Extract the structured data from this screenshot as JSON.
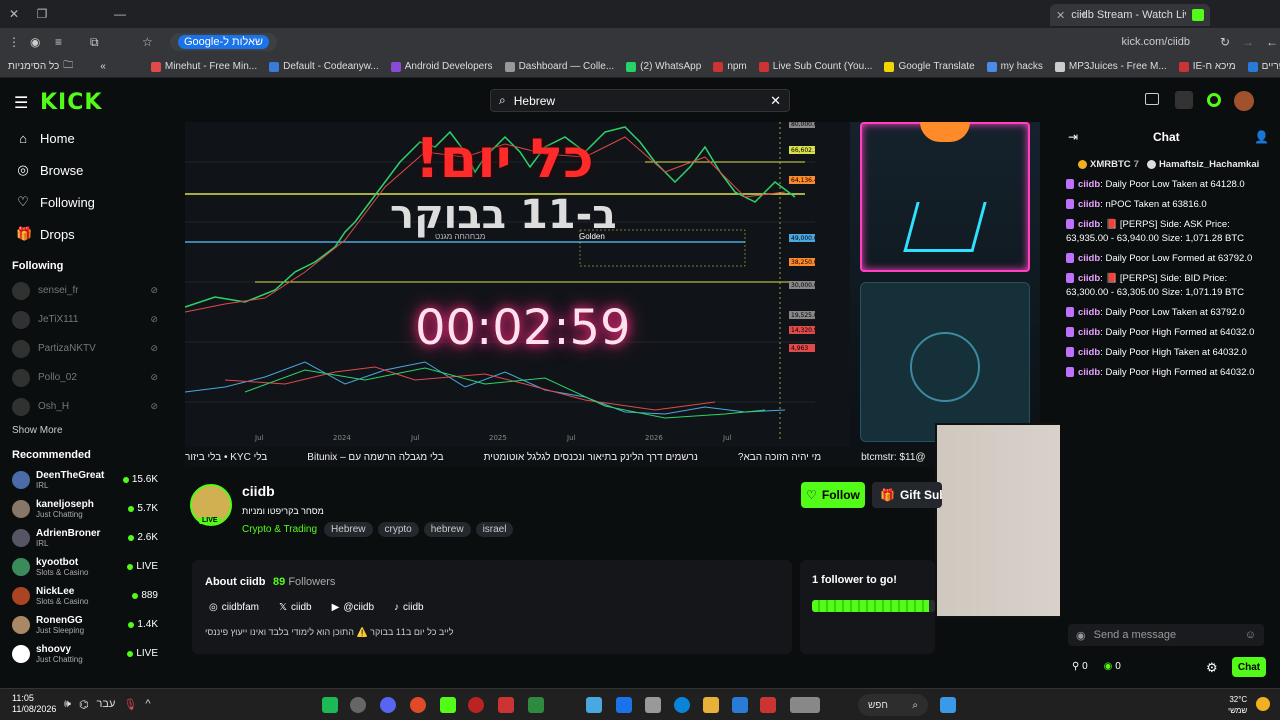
{
  "browser": {
    "tab_title": "ciidb Stream - Watch Live o",
    "omnibox_chip": "Google-שאלות ל",
    "url": "kick.com/ciidb",
    "bookmarks": [
      "Minehut - Free Min...",
      "Default - Codeanyw...",
      "Android Developers",
      "Dashboard — Colle...",
      "(2) WhatsApp",
      "npm",
      "Live Sub Count (You...",
      "Google Translate",
      "my hacks",
      "MP3Juices - Free M...",
      "IE-מיכא ח",
      "ספריים"
    ],
    "bookmarks_left": "כל הסימניות"
  },
  "header": {
    "logo": "KICK",
    "search_value": "Hebrew"
  },
  "sidebar": {
    "nav": [
      {
        "label": "Home",
        "icon": "home-icon"
      },
      {
        "label": "Browse",
        "icon": "compass-icon"
      },
      {
        "label": "Following",
        "icon": "heart-icon"
      },
      {
        "label": "Drops",
        "icon": "gift-icon"
      }
    ],
    "following_title": "Following",
    "following": [
      "sensei_fr",
      "JeTiX111",
      "PartizaNKTV",
      "Pollo_02",
      "Osh_H"
    ],
    "show_more": "Show More",
    "recommended_title": "Recommended",
    "recommended": [
      {
        "name": "DeenTheGreat",
        "category": "IRL",
        "viewers": "15.6K"
      },
      {
        "name": "kaneljoseph",
        "category": "Just Chatting",
        "viewers": "5.7K"
      },
      {
        "name": "AdrienBroner",
        "category": "IRL",
        "viewers": "2.6K"
      },
      {
        "name": "kyootbot",
        "category": "Slots & Casino",
        "viewers": "LIVE"
      },
      {
        "name": "NickLee",
        "category": "Slots & Casino",
        "viewers": "889"
      },
      {
        "name": "RonenGG",
        "category": "Just Sleeping",
        "viewers": "1.4K"
      },
      {
        "name": "shoovy",
        "category": "Just Chatting",
        "viewers": "LIVE"
      }
    ]
  },
  "video": {
    "overlay_title": "כל יום!",
    "overlay_sub": "ב-11 בבוקר",
    "overlay_small": "מבחהחה מגנט",
    "golden_label": "Golden",
    "timer": "00:02:59",
    "ticker": [
      "בלי KYC • בלי ביזור",
      "בלי מגבלה הרשמה עם – Bitunix",
      "נרשמים דרך הלינק בתיאור ונכנסים לגלגל אוטומטית",
      "מי יהיה הזוכה הבא?",
      "@btcmstr: $11"
    ],
    "x_ticks": [
      "Jul",
      "2024",
      "Jul",
      "2025",
      "Jul",
      "2026",
      "Jul"
    ],
    "price_labels": [
      "80,000.0",
      "66,602.1",
      "64,136.4",
      "49,000.0",
      "38,250.0",
      "30,000.0",
      "19,525.0",
      "14,320.9",
      "4,963"
    ]
  },
  "channel": {
    "name": "ciidb",
    "subtitle": "מסחר בקריפטו ומניות",
    "category": "Crypto & Trading",
    "tags": [
      "Hebrew",
      "crypto",
      "hebrew",
      "israel"
    ],
    "live_badge": "LIVE",
    "follow_label": "Follow",
    "gift_label": "Gift Subs"
  },
  "about": {
    "title": "About ciidb",
    "followers_count": "89",
    "followers_label": "Followers",
    "socials": [
      {
        "icon": "instagram-icon",
        "label": "ciidbfam"
      },
      {
        "icon": "x-icon",
        "label": "ciidb"
      },
      {
        "icon": "youtube-icon",
        "label": "@ciidb"
      },
      {
        "icon": "tiktok-icon",
        "label": "ciidb"
      }
    ],
    "description": "לייב כל יום ב11 בבוקר ⚠️ התוכן הוא לימודי בלבד ואינו ייעוץ פיננסי"
  },
  "goal": {
    "text": "1 follower to go!",
    "progress": 0.95
  },
  "chat": {
    "title": "Chat",
    "pinned": [
      {
        "user": "XMRBTC",
        "count": "7"
      },
      {
        "user": "Hamaftsiz_Hachamkai"
      }
    ],
    "messages": [
      {
        "user": "ciidb",
        "text": "Daily Poor Low Taken at 64128.0"
      },
      {
        "user": "ciidb",
        "text": "nPOC Taken at 63816.0"
      },
      {
        "user": "ciidb",
        "text": "📕 [PERPS] Side: ASK Price: 63,935.00 - 63,940.00 Size: 1,071.28 BTC"
      },
      {
        "user": "ciidb",
        "text": "Daily Poor Low Formed at 63792.0"
      },
      {
        "user": "ciidb",
        "text": "📕 [PERPS] Side: BID Price: 63,300.00 - 63,305.00 Size: 1,071.19 BTC"
      },
      {
        "user": "ciidb",
        "text": "Daily Poor Low Taken at 63792.0"
      },
      {
        "user": "ciidb",
        "text": "Daily Poor High Formed at 64032.0"
      },
      {
        "user": "ciidb",
        "text": "Daily Poor High Taken at 64032.0"
      },
      {
        "user": "ciidb",
        "text": "Daily Poor High Formed at 64032.0"
      }
    ],
    "input_placeholder": "Send a message",
    "stat1": "0",
    "stat2": "0",
    "chat_button": "Chat"
  },
  "taskbar": {
    "time": "11:05",
    "date": "11/08/2026",
    "lang": "עבר",
    "search_text": "חפש",
    "weather": "32°C",
    "weather_sub": "שמשי"
  },
  "colors": {
    "kick_green": "#53fc18",
    "background": "#0b0e0f",
    "timer_glow": "#ff2a80"
  }
}
